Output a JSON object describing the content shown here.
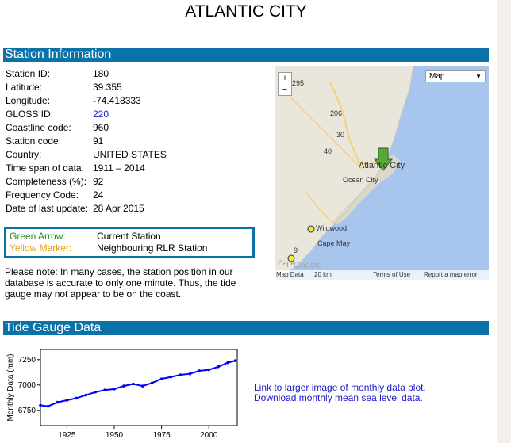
{
  "page": {
    "title": "ATLANTIC CITY"
  },
  "station_info": {
    "heading": "Station Information",
    "rows": [
      {
        "label": "Station ID:",
        "value": "180"
      },
      {
        "label": "Latitude:",
        "value": "39.355"
      },
      {
        "label": "Longitude:",
        "value": "-74.418333"
      },
      {
        "label": "GLOSS ID:",
        "value": "220",
        "link": true
      },
      {
        "label": "Coastline code:",
        "value": "960"
      },
      {
        "label": "Station code:",
        "value": "91"
      },
      {
        "label": "Country:",
        "value": "UNITED STATES"
      },
      {
        "label": "Time span of data:",
        "value": "1911 – 2014"
      },
      {
        "label": "Completeness (%):",
        "value": "92"
      },
      {
        "label": "Frequency Code:",
        "value": "24"
      },
      {
        "label": "Date of last update:",
        "value": "28 Apr 2015"
      }
    ]
  },
  "legend": {
    "green_key": "Green Arrow:",
    "green_value": "Current Station",
    "yellow_key": "Yellow Marker:",
    "yellow_value": "Neighbouring RLR Station",
    "green_color": "#2a8a2a",
    "yellow_color": "#e0a018"
  },
  "note": "Please note: In many cases, the station position in our database is accurate to only one minute. Thus, the tide gauge may not appear to be on the coast.",
  "map": {
    "type_select": "Map",
    "zoom_in": "+",
    "zoom_out": "−",
    "labels": {
      "atlantic_city": "Atlantic City",
      "ocean_city": "Ocean City",
      "wildwood": "Wildwood",
      "cape_may": "Cape May",
      "route_206": "206",
      "route_30": "30",
      "route_40": "40",
      "route_295": "295",
      "route_9": "9",
      "google": "Google",
      "cape_may_point": "Cape"
    },
    "footer": {
      "data": "Map Data",
      "scale": "20 km",
      "terms": "Terms of Use",
      "report": "Report a map error"
    },
    "water_color": "#a8c5ee",
    "land_color": "#e9e6dc"
  },
  "tide_gauge": {
    "heading": "Tide Gauge Data",
    "link_larger": "Link to larger image of monthly data plot.",
    "link_download": "Download monthly mean sea level data."
  },
  "chart_data": {
    "type": "line",
    "ylabel": "Monthly Data (mm)",
    "xlabel": "",
    "x_ticks": [
      1925,
      1950,
      1975,
      2000
    ],
    "y_ticks": [
      6750,
      7000,
      7250
    ],
    "xlim": [
      1911,
      2015
    ],
    "ylim": [
      6600,
      7350
    ],
    "series": [
      {
        "color": "#0000ff",
        "x": [
          1911,
          1915,
          1920,
          1925,
          1930,
          1935,
          1940,
          1945,
          1950,
          1955,
          1960,
          1965,
          1970,
          1975,
          1980,
          1985,
          1990,
          1995,
          2000,
          2005,
          2010,
          2014
        ],
        "values": [
          6800,
          6790,
          6830,
          6850,
          6870,
          6900,
          6930,
          6950,
          6960,
          6990,
          7010,
          6990,
          7020,
          7060,
          7080,
          7100,
          7110,
          7140,
          7150,
          7180,
          7220,
          7240
        ]
      }
    ]
  }
}
